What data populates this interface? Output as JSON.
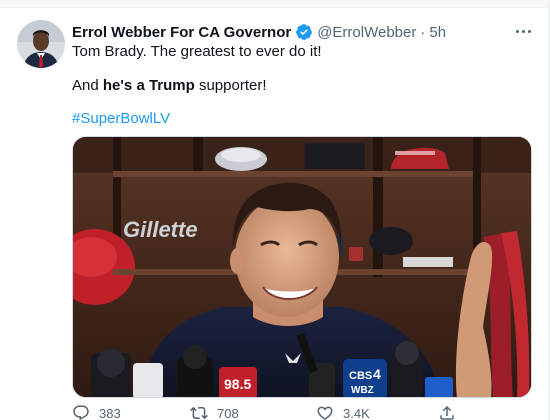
{
  "tweet": {
    "display_name": "Errol Webber For CA Governor",
    "handle": "@ErrolWebber",
    "separator": "·",
    "time": "5h",
    "line1": "Tom Brady. The greatest to ever do it!",
    "line2_part1": "And ",
    "line2_bold1": "he's a Trump",
    "line2_part2": " supporter!",
    "hashtag": "#SuperBowlLV",
    "verified_icon": "verified-badge-icon",
    "more_icon": "more-dots-icon"
  },
  "media": {
    "locker_brand": "Gillette",
    "mic_labels": [
      "CBS",
      "4",
      "WBZ"
    ]
  },
  "actions": {
    "reply_count": "383",
    "retweet_count": "708",
    "like_count": "3.4K",
    "reply_icon": "reply-icon",
    "retweet_icon": "retweet-icon",
    "like_icon": "heart-icon",
    "share_icon": "share-icon"
  },
  "colors": {
    "accent": "#1d9bf0",
    "text": "#0f1419",
    "secondary": "#536471"
  }
}
